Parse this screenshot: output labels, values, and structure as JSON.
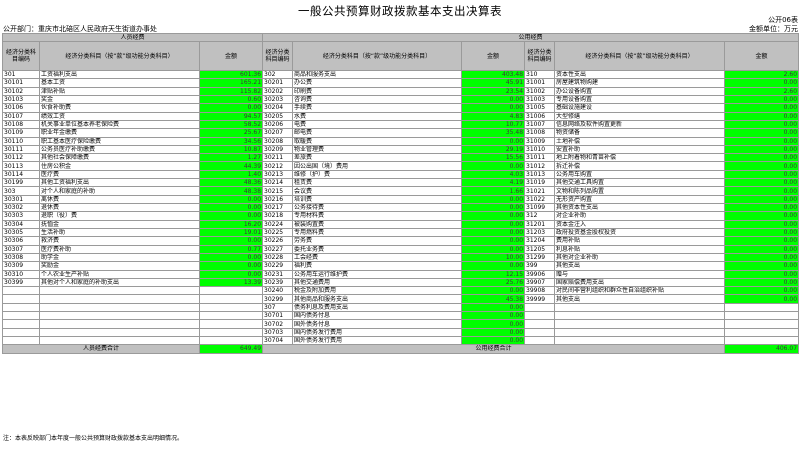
{
  "header": {
    "title": "一般公共预算财政拨款基本支出决算表",
    "table_no": "公开06表",
    "department": "公开部门：重庆市北碚区人民政府天生街道办事处",
    "unit": "金额单位：万元"
  },
  "columns": {
    "personnel_group": "人员经费",
    "public_group": "公用经费",
    "code": "经济分类科目编码",
    "name": "经济分类科目（按“款”级功能分类科目）",
    "amount": "金额"
  },
  "rows": [
    {
      "c1": "301",
      "n1": "工资福利支出",
      "a1": "601.36",
      "c2": "302",
      "n2": "商品和服务支出",
      "a2": "403.48",
      "c3": "310",
      "n3": "资本性支出",
      "a3": "2.60"
    },
    {
      "c1": "30101",
      "n1": "基本工资",
      "a1": "165.21",
      "c2": "30201",
      "n2": "办公费",
      "a2": "45.91",
      "c3": "31001",
      "n3": "房屋建筑物购建",
      "a3": "0.00"
    },
    {
      "c1": "30102",
      "n1": "津贴补贴",
      "a1": "115.82",
      "c2": "30202",
      "n2": "印刷费",
      "a2": "23.54",
      "c3": "31002",
      "n3": "办公设备购置",
      "a3": "2.60"
    },
    {
      "c1": "30103",
      "n1": "奖金",
      "a1": "0.60",
      "c2": "30203",
      "n2": "咨询费",
      "a2": "0.00",
      "c3": "31003",
      "n3": "专用设备购置",
      "a3": "0.00"
    },
    {
      "c1": "30106",
      "n1": "伙食补助费",
      "a1": "0.00",
      "c2": "30204",
      "n2": "手续费",
      "a2": "0.00",
      "c3": "31005",
      "n3": "基础设施建设",
      "a3": "0.00"
    },
    {
      "c1": "30107",
      "n1": "绩效工资",
      "a1": "94.57",
      "c2": "30205",
      "n2": "水费",
      "a2": "4.83",
      "c3": "31006",
      "n3": "大型修缮",
      "a3": "0.00"
    },
    {
      "c1": "30108",
      "n1": "机关事业单位基本养老保险费",
      "a1": "58.52",
      "c2": "30206",
      "n2": "电费",
      "a2": "10.77",
      "c3": "31007",
      "n3": "信息网络及软件购置更新",
      "a3": "0.00"
    },
    {
      "c1": "30109",
      "n1": "职业年金缴费",
      "a1": "25.67",
      "c2": "30207",
      "n2": "邮电费",
      "a2": "35.48",
      "c3": "31008",
      "n3": "物资储备",
      "a3": "0.00"
    },
    {
      "c1": "30110",
      "n1": "职工基本医疗保险缴费",
      "a1": "34.56",
      "c2": "30208",
      "n2": "取暖费",
      "a2": "0.00",
      "c3": "31009",
      "n3": "土地补偿",
      "a3": "0.00"
    },
    {
      "c1": "30111",
      "n1": "公务员医疗补助缴费",
      "a1": "10.87",
      "c2": "30209",
      "n2": "物业管理费",
      "a2": "29.19",
      "c3": "31010",
      "n3": "安置补助",
      "a3": "0.00"
    },
    {
      "c1": "30112",
      "n1": "其他社会保障缴费",
      "a1": "1.27",
      "c2": "30211",
      "n2": "差旅费",
      "a2": "15.56",
      "c3": "31011",
      "n3": "地上附着物和青苗补偿",
      "a3": "0.00"
    },
    {
      "c1": "30113",
      "n1": "住房公积金",
      "a1": "44.39",
      "c2": "30212",
      "n2": "因公出国（境）费用",
      "a2": "0.00",
      "c3": "31012",
      "n3": "拆迁补偿",
      "a3": "0.00"
    },
    {
      "c1": "30114",
      "n1": "医疗费",
      "a1": "1.40",
      "c2": "30213",
      "n2": "维修（护）费",
      "a2": "4.03",
      "c3": "31013",
      "n3": "公务用车购置",
      "a3": "0.00"
    },
    {
      "c1": "30199",
      "n1": "其他工资福利支出",
      "a1": "48.36",
      "c2": "30214",
      "n2": "租赁费",
      "a2": "4.19",
      "c3": "31019",
      "n3": "其他交通工具购置",
      "a3": "0.00"
    },
    {
      "c1": "303",
      "n1": "对个人和家庭的补助",
      "a1": "48.38",
      "c2": "30215",
      "n2": "会议费",
      "a2": "1.66",
      "c3": "31021",
      "n3": "文物和陈列品购置",
      "a3": "0.00"
    },
    {
      "c1": "30301",
      "n1": "离休费",
      "a1": "0.00",
      "c2": "30216",
      "n2": "培训费",
      "a2": "0.00",
      "c3": "31022",
      "n3": "无形资产购置",
      "a3": "0.00"
    },
    {
      "c1": "30302",
      "n1": "退休费",
      "a1": "0.00",
      "c2": "30217",
      "n2": "公务接待费",
      "a2": "0.00",
      "c3": "31099",
      "n3": "其他资本性支出",
      "a3": "0.00"
    },
    {
      "c1": "30303",
      "n1": "退职（役）费",
      "a1": "0.00",
      "c2": "30218",
      "n2": "专用材料费",
      "a2": "0.00",
      "c3": "312",
      "n3": "对企业补助",
      "a3": "0.00"
    },
    {
      "c1": "30304",
      "n1": "抚恤金",
      "a1": "16.20",
      "c2": "30224",
      "n2": "被装购置费",
      "a2": "0.00",
      "c3": "31201",
      "n3": "资本金注入",
      "a3": "0.00"
    },
    {
      "c1": "30305",
      "n1": "生活补助",
      "a1": "19.01",
      "c2": "30225",
      "n2": "专用燃料费",
      "a2": "0.00",
      "c3": "31203",
      "n3": "政府投资基金股权投资",
      "a3": "0.00"
    },
    {
      "c1": "30306",
      "n1": "救济费",
      "a1": "0.00",
      "c2": "30226",
      "n2": "劳务费",
      "a2": "0.00",
      "c3": "31204",
      "n3": "费用补贴",
      "a3": "0.00"
    },
    {
      "c1": "30307",
      "n1": "医疗费补助",
      "a1": "0.77",
      "c2": "30227",
      "n2": "委托业务费",
      "a2": "0.00",
      "c3": "31205",
      "n3": "利息补贴",
      "a3": "0.00"
    },
    {
      "c1": "30308",
      "n1": "助学金",
      "a1": "0.00",
      "c2": "30228",
      "n2": "工会经费",
      "a2": "10.00",
      "c3": "31299",
      "n3": "其他对企业补助",
      "a3": "0.00"
    },
    {
      "c1": "30309",
      "n1": "奖励金",
      "a1": "0.00",
      "c2": "30229",
      "n2": "福利费",
      "a2": "0.00",
      "c3": "399",
      "n3": "其他支出",
      "a3": "0.00"
    },
    {
      "c1": "30310",
      "n1": "个人农业生产补贴",
      "a1": "0.00",
      "c2": "30231",
      "n2": "公务用车运行维护费",
      "a2": "12.15",
      "c3": "39906",
      "n3": "赠与",
      "a3": "0.00"
    },
    {
      "c1": "30399",
      "n1": "其他对个人和家庭的补助支出",
      "a1": "13.39",
      "c2": "30239",
      "n2": "其他交通费用",
      "a2": "25.76",
      "c3": "39907",
      "n3": "国家赔偿费用支出",
      "a3": "0.00"
    },
    {
      "c1": "",
      "n1": "",
      "a1": "",
      "c2": "30240",
      "n2": "税金及附加费用",
      "a2": "0.00",
      "c3": "39908",
      "n3": "对民间非营利组织和群众性自治组织补贴",
      "a3": "0.00"
    },
    {
      "c1": "",
      "n1": "",
      "a1": "",
      "c2": "30299",
      "n2": "其他商品和服务支出",
      "a2": "45.38",
      "c3": "39999",
      "n3": "其他支出",
      "a3": "0.00"
    },
    {
      "c1": "",
      "n1": "",
      "a1": "",
      "c2": "307",
      "n2": "债务利息及费用支出",
      "a2": "0.00",
      "c3": "",
      "n3": "",
      "a3": ""
    },
    {
      "c1": "",
      "n1": "",
      "a1": "",
      "c2": "30701",
      "n2": "国内债务付息",
      "a2": "0.00",
      "c3": "",
      "n3": "",
      "a3": ""
    },
    {
      "c1": "",
      "n1": "",
      "a1": "",
      "c2": "30702",
      "n2": "国外债务付息",
      "a2": "0.00",
      "c3": "",
      "n3": "",
      "a3": ""
    },
    {
      "c1": "",
      "n1": "",
      "a1": "",
      "c2": "30703",
      "n2": "国内债务发行费用",
      "a2": "0.00",
      "c3": "",
      "n3": "",
      "a3": ""
    },
    {
      "c1": "",
      "n1": "",
      "a1": "",
      "c2": "30704",
      "n2": "国外债务发行费用",
      "a2": "0.00",
      "c3": "",
      "n3": "",
      "a3": ""
    }
  ],
  "totals": {
    "personnel_label": "人员经费合计",
    "personnel_amount": "649.49",
    "public_label": "公用经费合计",
    "public_amount": "406.07"
  },
  "footnote": "注：本表反映部门本年度一般公共预算财政拨款基本支出明细情况。",
  "colors": {
    "highlight": "#00ff00",
    "header_gray": "#c0c0c0"
  }
}
